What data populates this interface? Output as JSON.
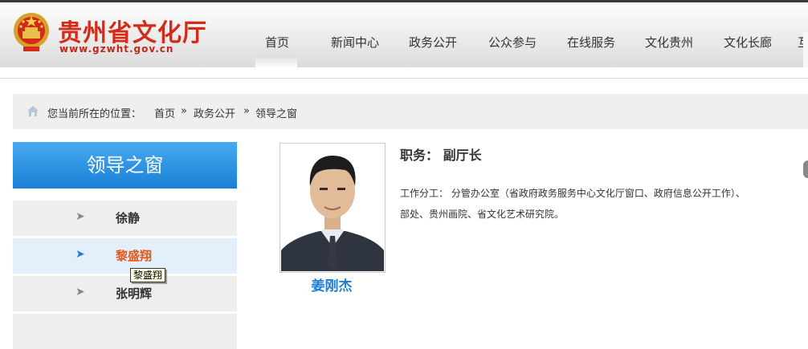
{
  "header": {
    "site_title": "贵州省文化厅",
    "site_url": "www.gzwht.gov.cn",
    "nav": [
      "首页",
      "新闻中心",
      "政务公开",
      "公众参与",
      "在线服务",
      "文化贵州",
      "文化长廊",
      "互"
    ],
    "active_nav": "首页"
  },
  "breadcrumb": {
    "prefix": "您当前所在的位置：",
    "items": [
      "首页",
      "政务公开",
      "领导之窗"
    ],
    "separator": "»"
  },
  "sidebar": {
    "title": "领导之窗",
    "arrow": "➤",
    "items": [
      {
        "name": "徐静"
      },
      {
        "name": "黎盛翔"
      },
      {
        "name": "张明辉"
      }
    ],
    "tooltip": "黎盛翔"
  },
  "profile": {
    "name": "姜刚杰",
    "position": "职务：  副厅长",
    "duty_line1": "工作分工：  分管办公室（省政府政务服务中心文化厅窗口、政府信息公开工作）、",
    "duty_line2": "部处、贵州画院、省文化艺术研究院。"
  },
  "colors": {
    "brand_red": "#d42a18",
    "sidebar_blue": "#1a7fd6",
    "active_orange": "#e2561a"
  }
}
